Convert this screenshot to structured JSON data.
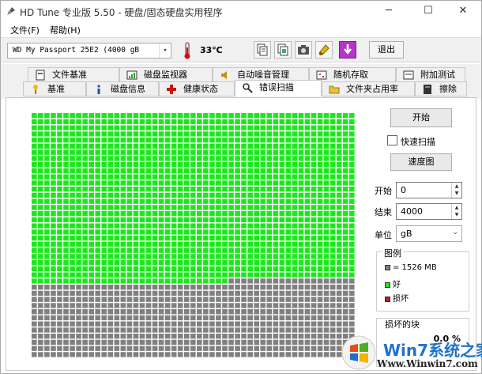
{
  "window": {
    "title": "HD Tune 专业版 5.50 - 硬盘/固态硬盘实用程序",
    "minimize_glyph": "─",
    "maximize_glyph": "☐",
    "close_glyph": "✕"
  },
  "menu": {
    "items": [
      "文件(F)",
      "帮助(H)"
    ]
  },
  "toolbar": {
    "drive": "WD    My Passport 25E2 (4000 gB",
    "temperature": "33℃",
    "exit_label": "退出",
    "icons": [
      "copy-text-icon",
      "copy-info-icon",
      "screenshot-icon",
      "options-icon",
      "save-icon"
    ]
  },
  "tabs": {
    "row1": [
      {
        "label": "文件基准",
        "icon": "file-benchmark-icon"
      },
      {
        "label": "磁盘监视器",
        "icon": "disk-monitor-icon"
      },
      {
        "label": "自动噪音管理",
        "icon": "speaker-icon"
      },
      {
        "label": "随机存取",
        "icon": "random-access-icon"
      },
      {
        "label": "附加测试",
        "icon": "extra-tests-icon"
      }
    ],
    "row2": [
      {
        "label": "基准",
        "icon": "benchmark-icon"
      },
      {
        "label": "磁盘信息",
        "icon": "info-icon"
      },
      {
        "label": "健康状态",
        "icon": "health-icon"
      },
      {
        "label": "错误扫描",
        "icon": "error-scan-icon"
      },
      {
        "label": "文件夹占用率",
        "icon": "folder-usage-icon"
      },
      {
        "label": "擦除",
        "icon": "erase-icon"
      }
    ],
    "active": "错误扫描"
  },
  "scan": {
    "start_button": "开始",
    "quick_scan_label": "快速扫描",
    "quick_scan_checked": false,
    "speed_map_button": "速度图",
    "start_label": "开始",
    "start_value": "0",
    "end_label": "结束",
    "end_value": "4000",
    "unit_label": "单位",
    "unit_value": "gB",
    "progress_fraction": 0.69
  },
  "legend": {
    "title": "图例",
    "block_size": "= 1526 MB",
    "good": "好",
    "bad": "损坏",
    "colors": {
      "untested": "#808080",
      "good": "#1ee61e",
      "bad": "#b22222"
    }
  },
  "damaged": {
    "title": "损坏的块",
    "value": "0.0 %"
  },
  "watermark": {
    "text": "Win7系统之家",
    "url": "Www.Winwin7.com"
  }
}
